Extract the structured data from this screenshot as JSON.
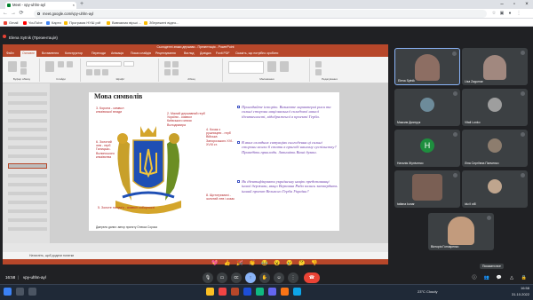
{
  "browser": {
    "tab_title": "Meet - vpy-uhhn-ayl",
    "new_tab": "+",
    "url": "meet.google.com/vpy-uhhn-ayl",
    "bookmarks": [
      "Gmail",
      "YouTube",
      "Карти",
      "Програма НУШ pdf",
      "Вивчаємо вірші ...",
      "Збережені відео..."
    ]
  },
  "meet": {
    "presenter_label": "Elena Sytnik (Презентація)",
    "meeting_code": "vpy-uhhn-ayl",
    "time": "16:58",
    "tooltip": "Показати все",
    "reactions": [
      "💖",
      "👍",
      "🎉",
      "👏",
      "😂",
      "😮",
      "😢",
      "🤔",
      "👎"
    ]
  },
  "ppt": {
    "window_title": "Сьогоденні знаки держави - Презентація - PowerPoint",
    "tabs": [
      "Файл",
      "Основне",
      "Вставлення",
      "Конструктор",
      "Переходи",
      "Анімація",
      "Показ слайдів",
      "Рецензування",
      "Вигляд",
      "Довідка",
      "Foxit PDF",
      "Скажіть, що потрібно зробити"
    ],
    "ribbon_groups": [
      "Буфер обміну",
      "Слайди",
      "Шрифт",
      "Абзац",
      "Малювання",
      "Редагування"
    ],
    "notes": "Натисніть, щоб додати нотатки",
    "slide": {
      "title": "Мова символів",
      "labels": [
        {
          "text": "3. Корона - символ князівської влади"
        },
        {
          "text": "2. Малий державний герб України - символ Київського князя Володимира"
        },
        {
          "text": "4. Козак з рушницею - герб Війська Запорозького XVI-XVIII ст."
        },
        {
          "text": "6. Золотий лев - герб Галицько-Волинського князівства"
        },
        {
          "text": "5. Золоте полум'я - символ соборності"
        },
        {
          "text": "8. Щитотримачі - золотий лев і козак"
        }
      ],
      "questions": [
        "Пригадайте історію. Визначте характерні риси та сильні сторони національної складової нашої ідентичності, відображеної в проекті Герба.",
        "В яких складних ситуаціях сьогодення ці сильні сторони могли б стати в пригоді нашому суспільству? Приведіть приклади. Запишіть Ваші думки.",
        "Як ідентифікувати українську націю представниці іншої держави, якщо Верховна Рада колись затвердить інший проект Великого Герба України?"
      ],
      "credit": "Джерело даних: автор проекту Олекса Сорока"
    }
  },
  "participants": [
    {
      "name": "Elena Sytnik",
      "color": "#8d6e63"
    },
    {
      "name": "Lisa Zagumar",
      "color": "#a1887f"
    },
    {
      "name": "Максим Дмитрук",
      "color": "#6d8b9a"
    },
    {
      "name": "Vitali Lonko",
      "color": "#9e9e9e"
    },
    {
      "name": "Наталія Жупіченко",
      "initial": "Н",
      "color": "#1e8e3e"
    },
    {
      "name": "Ліна Сергіївна Панченко",
      "color": "#8d7d6e"
    },
    {
      "name": "tatiana kunar",
      "color": "#7a5f54"
    },
    {
      "name": "idu il ot8",
      "color": "#bfa58e"
    },
    {
      "name": "Вікторія Гончаренко",
      "color": "#c29b7d"
    }
  ],
  "taskbar": {
    "weather": "23°C Cloudy",
    "clock": "16:58",
    "date": "31.10.2022"
  }
}
